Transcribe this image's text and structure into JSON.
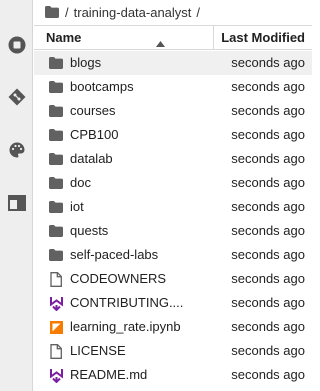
{
  "breadcrumb": {
    "separator1": "/",
    "segment": "training-data-analyst",
    "separator2": "/"
  },
  "header": {
    "name_label": "Name",
    "modified_label": "Last Modified"
  },
  "files": [
    {
      "name": "blogs",
      "modified": "seconds ago",
      "icon": "folder-icon",
      "selected": true
    },
    {
      "name": "bootcamps",
      "modified": "seconds ago",
      "icon": "folder-icon"
    },
    {
      "name": "courses",
      "modified": "seconds ago",
      "icon": "folder-icon"
    },
    {
      "name": "CPB100",
      "modified": "seconds ago",
      "icon": "folder-icon"
    },
    {
      "name": "datalab",
      "modified": "seconds ago",
      "icon": "folder-icon"
    },
    {
      "name": "doc",
      "modified": "seconds ago",
      "icon": "folder-icon"
    },
    {
      "name": "iot",
      "modified": "seconds ago",
      "icon": "folder-icon"
    },
    {
      "name": "quests",
      "modified": "seconds ago",
      "icon": "folder-icon"
    },
    {
      "name": "self-paced-labs",
      "modified": "seconds ago",
      "icon": "folder-icon"
    },
    {
      "name": "CODEOWNERS",
      "modified": "seconds ago",
      "icon": "file-icon"
    },
    {
      "name": "CONTRIBUTING....",
      "modified": "seconds ago",
      "icon": "markdown-icon"
    },
    {
      "name": "learning_rate.ipynb",
      "modified": "seconds ago",
      "icon": "notebook-icon"
    },
    {
      "name": "LICENSE",
      "modified": "seconds ago",
      "icon": "file-icon"
    },
    {
      "name": "README.md",
      "modified": "seconds ago",
      "icon": "markdown-icon"
    }
  ],
  "colors": {
    "folder": "#616161",
    "markdown": "#7b1fa2",
    "notebook": "#f57c00",
    "sidebar_bg": "#eeeeee",
    "selected_row": "#f0f0f0"
  }
}
